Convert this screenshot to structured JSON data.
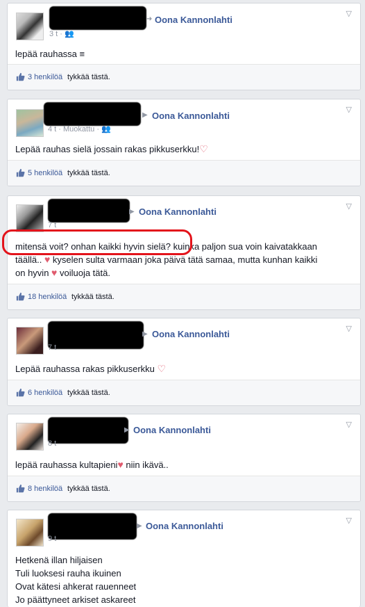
{
  "posts": [
    {
      "target": "Oona Kannonlahti",
      "time": "3 t",
      "edited": "",
      "text": "lepää rauhassa ≡",
      "likes_count": "3 henkilöä",
      "likes_suffix": "tykkää tästä."
    },
    {
      "target": "Oona Kannonlahti",
      "time": "4 t",
      "edited": "Muokattu",
      "text": "Lepää rauhas sielä jossain rakas pikkuserkku!",
      "likes_count": "5 henkilöä",
      "likes_suffix": "tykkää tästä."
    },
    {
      "target": "Oona Kannonlahti",
      "time": "7 t",
      "edited": "",
      "text_lines": [
        "mitensä voit? onhan kaikki hyvin sielä? kuinka paljon sua voin kaivatakkaan",
        "täällä..",
        "kyselen sulta varmaan joka päivä tätä samaa, mutta kunhan kaikki",
        "on hyvin",
        "voiluoja tätä."
      ],
      "likes_count": "18 henkilöä",
      "likes_suffix": "tykkää tästä."
    },
    {
      "target": "Oona Kannonlahti",
      "time": "7 t",
      "edited": "",
      "text": "Lepää rauhassa rakas pikkuserkku",
      "likes_count": "6 henkilöä",
      "likes_suffix": "tykkää tästä."
    },
    {
      "target": "Oona Kannonlahti",
      "time": "8 t",
      "edited": "",
      "text": "lepää rauhassa kultapieni",
      "text_after": "niin ikävä..",
      "likes_count": "8 henkilöä",
      "likes_suffix": "tykkää tästä."
    },
    {
      "target": "Oona Kannonlahti",
      "time": "9 t",
      "edited": "",
      "text_lines": [
        "Hetkenä illan hiljaisen",
        "Tuli luoksesi rauha ikuinen",
        "Ovat kätesi ahkerat rauenneet",
        "Jo päättyneet arkiset askareet"
      ]
    }
  ],
  "colors": {
    "link": "#3b5998",
    "muted": "#9197a3",
    "heart": "#e05b6e",
    "annotation": "#e3131b"
  },
  "icons": {
    "like": "thumbs-up-icon",
    "audience": "friends-icon",
    "menu": "chevron-down-icon",
    "arrow": "right-triangle-icon"
  }
}
